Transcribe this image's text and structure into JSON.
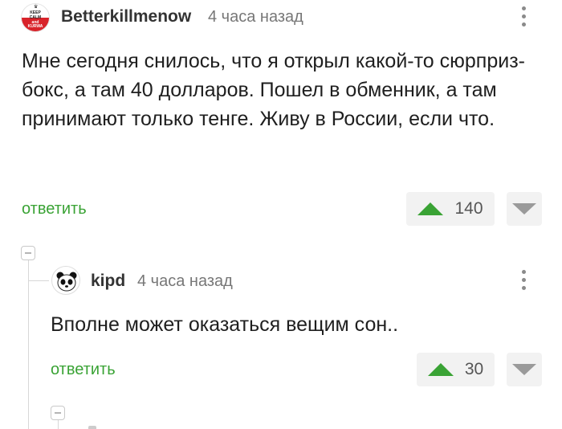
{
  "comments": [
    {
      "author": "Betterkillmenow",
      "time": "4 часа назад",
      "avatar_lines": [
        "KEEP",
        "CALM",
        "and",
        "KURWA"
      ],
      "text": "Мне сегодня снилось, что я открыл какой-то сюрприз-бокс, а там 40 долларов. Пошел в обменник, а там принимают только тенге. Живу в России, если что.",
      "reply_label": "ответить",
      "rating": "140"
    },
    {
      "author": "kipd",
      "time": "4 часа назад",
      "text": "Вполне может оказаться вещим сон..",
      "reply_label": "ответить",
      "rating": "30"
    }
  ],
  "icons": {
    "upvote": "triangle-up-icon",
    "downvote": "triangle-down-icon",
    "more": "vertical-dots-icon",
    "collapse": "collapse-minus-icon"
  },
  "colors": {
    "accent_green": "#3aa335",
    "downvote_gray": "#9a9a9a",
    "vote_bg": "#f2f2f2",
    "keep_calm_red": "#d8232a"
  }
}
